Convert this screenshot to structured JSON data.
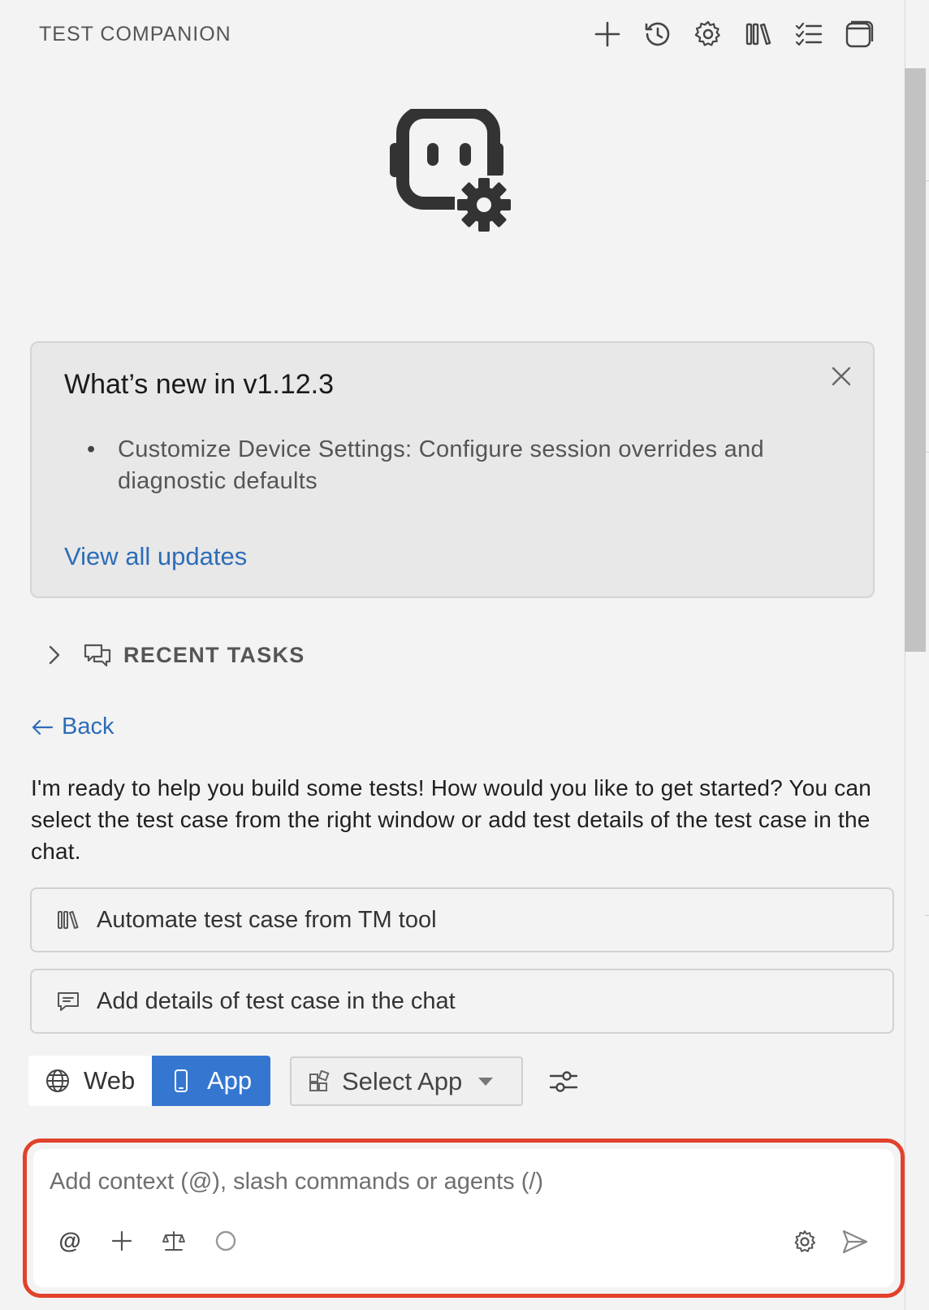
{
  "header": {
    "title": "TEST COMPANION",
    "toolbar_icons": [
      "plus-icon",
      "history-icon",
      "gear-icon",
      "library-icon",
      "checklist-icon",
      "panel-icon"
    ]
  },
  "whats_new": {
    "title": "What’s new in v1.12.3",
    "items": [
      "Customize Device Settings: Configure session overrides and diagnostic defaults"
    ],
    "link": "View all updates"
  },
  "recent_tasks": {
    "label": "RECENT TASKS"
  },
  "back": {
    "label": "Back"
  },
  "assistant_message": "I'm ready to help you build some tests! How would you like to get started? You can select the test case from the right window or add test details of the test case in the chat.",
  "options": [
    {
      "label": "Automate test case from TM tool",
      "icon": "library-icon"
    },
    {
      "label": "Add details of test case in the chat",
      "icon": "chat-icon"
    }
  ],
  "platform": {
    "web_label": "Web",
    "app_label": "App",
    "selected": "App"
  },
  "app_select": {
    "label": "Select App"
  },
  "chat": {
    "placeholder": "Add context (@), slash commands or agents (/)",
    "value": "",
    "at_label": "@"
  },
  "colors": {
    "accent": "#3577d0",
    "link": "#2d6db8",
    "highlight_border": "#e2412b",
    "background": "#f3f3f3"
  }
}
